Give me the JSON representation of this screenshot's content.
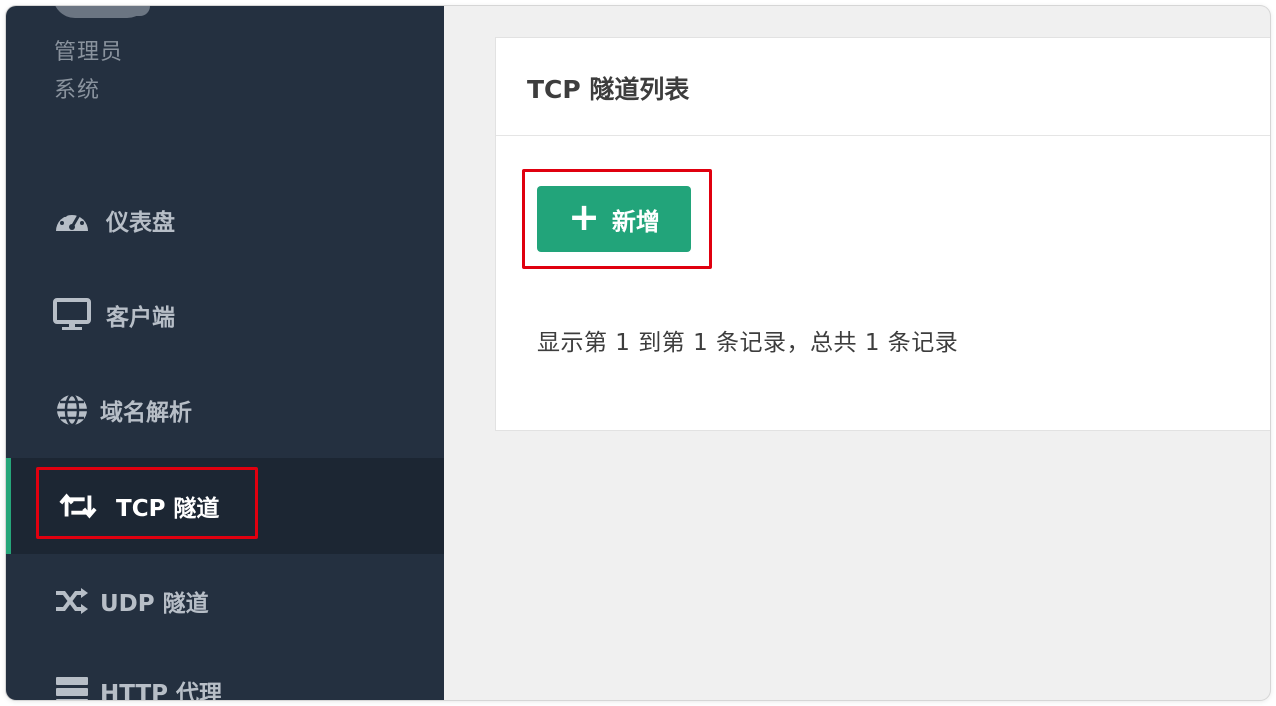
{
  "sidebar": {
    "user": {
      "name": "管理员",
      "role": "系统"
    },
    "items": [
      {
        "label": "仪表盘",
        "icon": "dashboard-icon"
      },
      {
        "label": "客户端",
        "icon": "monitor-icon"
      },
      {
        "label": "域名解析",
        "icon": "globe-icon"
      },
      {
        "label": "TCP 隧道",
        "icon": "retweet-icon",
        "active": true
      },
      {
        "label": "UDP 隧道",
        "icon": "shuffle-icon"
      },
      {
        "label": "HTTP 代理",
        "icon": "server-icon"
      }
    ]
  },
  "main": {
    "title": "TCP 隧道列表",
    "add_label": "新增",
    "add_icon": "plus-icon",
    "record_info": "显示第 1 到第 1 条记录，总共 1 条记录"
  },
  "colors": {
    "sidebar_bg": "#243040",
    "active_bg": "#1c2633",
    "accent": "#26a67a",
    "highlight": "#e0000f"
  }
}
